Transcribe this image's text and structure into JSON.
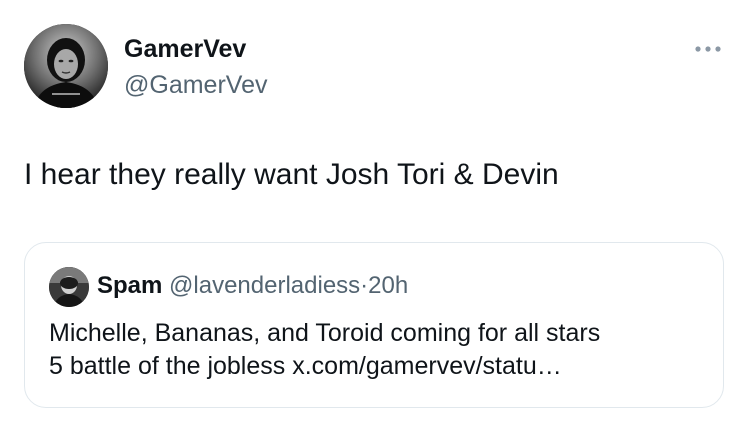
{
  "author": {
    "display_name": "GamerVev",
    "handle": "@GamerVev",
    "avatar_icon": "profile-photo-icon"
  },
  "more_icon": "more-options-icon",
  "tweet": {
    "text": "I hear they really want Josh Tori & Devin"
  },
  "quote": {
    "display_name": "Spam",
    "handle": "@lavenderladiess",
    "separator": "·",
    "time": "20h",
    "avatar_icon": "profile-photo-icon",
    "text_lines": [
      "Michelle, Bananas, and Toroid coming for all stars",
      "5 battle of the jobless x.com/gamervev/statu…"
    ]
  },
  "colors": {
    "text_primary": "#0f1419",
    "text_secondary": "#536471",
    "border": "#e1e8ed",
    "background": "#ffffff"
  }
}
